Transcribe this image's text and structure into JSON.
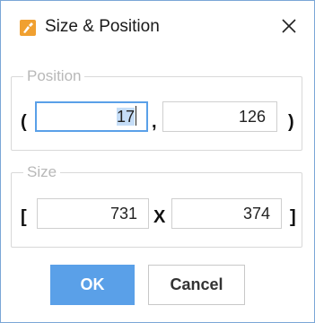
{
  "window": {
    "title": "Size & Position",
    "icon": "brush-tool-icon",
    "icon_color": "#f0a030"
  },
  "position": {
    "legend": "Position",
    "open": "(",
    "separator": ",",
    "close": ")",
    "x": "17",
    "y": "126"
  },
  "size": {
    "legend": "Size",
    "open": "[",
    "separator": "X",
    "close": "]",
    "width": "731",
    "height": "374"
  },
  "buttons": {
    "ok": "OK",
    "cancel": "Cancel"
  },
  "colors": {
    "accent": "#5aa0e8",
    "selection": "#c5ddf7"
  }
}
